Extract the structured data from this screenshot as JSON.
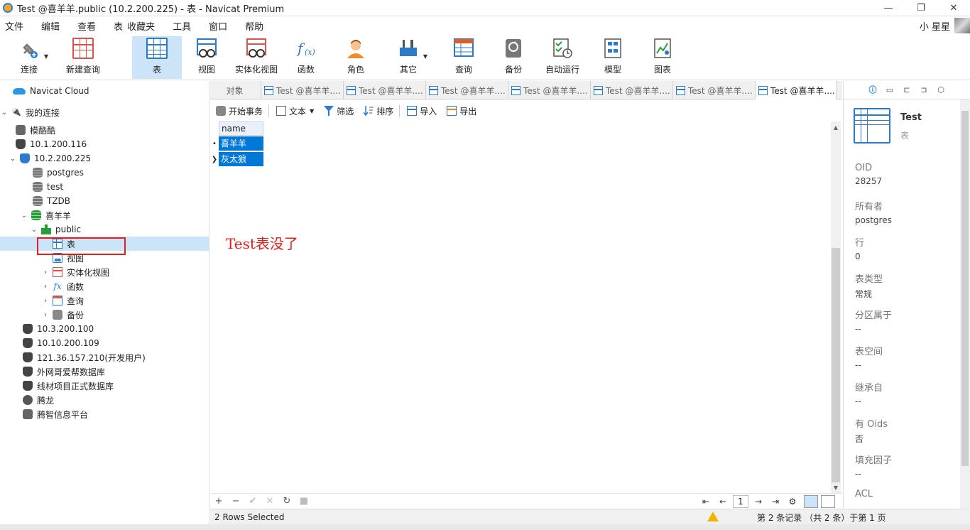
{
  "window": {
    "title": "Test @喜羊羊.public (10.2.200.225) - 表 - Navicat Premium",
    "controls": [
      "—",
      "❐",
      "✕"
    ]
  },
  "menu": [
    "文件",
    "编辑",
    "查看",
    "表",
    "收藏夹",
    "工具",
    "窗口",
    "帮助"
  ],
  "user": {
    "name": "小 星星"
  },
  "toolbar": [
    {
      "label": "连接",
      "icon": "plug-icon"
    },
    {
      "label": "新建查询",
      "icon": "new-query-icon"
    },
    {
      "label": "表",
      "icon": "table-icon",
      "active": true
    },
    {
      "label": "视图",
      "icon": "view-icon"
    },
    {
      "label": "实体化视图",
      "icon": "materialized-view-icon"
    },
    {
      "label": "函数",
      "icon": "function-icon"
    },
    {
      "label": "角色",
      "icon": "role-icon"
    },
    {
      "label": "其它",
      "icon": "tools-icon"
    },
    {
      "label": "查询",
      "icon": "query-icon"
    },
    {
      "label": "备份",
      "icon": "backup-icon"
    },
    {
      "label": "自动运行",
      "icon": "automation-icon"
    },
    {
      "label": "模型",
      "icon": "model-icon"
    },
    {
      "label": "图表",
      "icon": "chart-icon"
    }
  ],
  "nav": {
    "cloud": "Navicat Cloud",
    "my_connections": "我的连接",
    "items": [
      {
        "label": "模酷酷"
      },
      {
        "label": "10.1.200.116"
      },
      {
        "label": "10.2.200.225"
      },
      {
        "label": "postgres"
      },
      {
        "label": "test"
      },
      {
        "label": "TZDB"
      },
      {
        "label": "喜羊羊"
      },
      {
        "label": "public"
      },
      {
        "label": "表"
      },
      {
        "label": "视图"
      },
      {
        "label": "实体化视图"
      },
      {
        "label": "函数"
      },
      {
        "label": "查询"
      },
      {
        "label": "备份"
      },
      {
        "label": "10.3.200.100"
      },
      {
        "label": "10.10.200.109"
      },
      {
        "label": "121.36.157.210(开发用户)"
      },
      {
        "label": "外网哥爱帮数据库"
      },
      {
        "label": "线材项目正式数据库"
      },
      {
        "label": "腾龙"
      },
      {
        "label": "腾智信息平台"
      }
    ]
  },
  "tabs": {
    "object": "对象",
    "items": [
      "Test @喜羊羊....",
      "Test @喜羊羊....",
      "Test @喜羊羊....",
      "Test @喜羊羊....",
      "Test @喜羊羊....",
      "Test @喜羊羊....",
      "Test @喜羊羊...."
    ]
  },
  "content_toolbar": {
    "begin_tx": "开始事务",
    "text": "文本",
    "filter": "筛选",
    "sort": "排序",
    "import": "导入",
    "export": "导出"
  },
  "grid": {
    "column": "name",
    "rows": [
      "喜羊羊",
      "灰太狼"
    ],
    "row_markers": [
      "•",
      "❯"
    ]
  },
  "annotation": "Test表没了",
  "pager": {
    "page": "1"
  },
  "status": {
    "left": "2 Rows Selected",
    "right": "第 2 条记录 （共 2 条）于第 1 页"
  },
  "info": {
    "title": "Test",
    "subtitle": "表",
    "props": [
      {
        "k": "OID",
        "v": "28257"
      },
      {
        "k": "所有者",
        "v": "postgres"
      },
      {
        "k": "行",
        "v": "0"
      },
      {
        "k": "表类型",
        "v": "常规"
      },
      {
        "k": "分区属于",
        "v": "--"
      },
      {
        "k": "表空间",
        "v": "--"
      },
      {
        "k": "继承自",
        "v": "--"
      },
      {
        "k": "有 Oids",
        "v": "否"
      },
      {
        "k": "填充因子",
        "v": "--"
      },
      {
        "k": "ACL",
        "v": ""
      }
    ]
  }
}
